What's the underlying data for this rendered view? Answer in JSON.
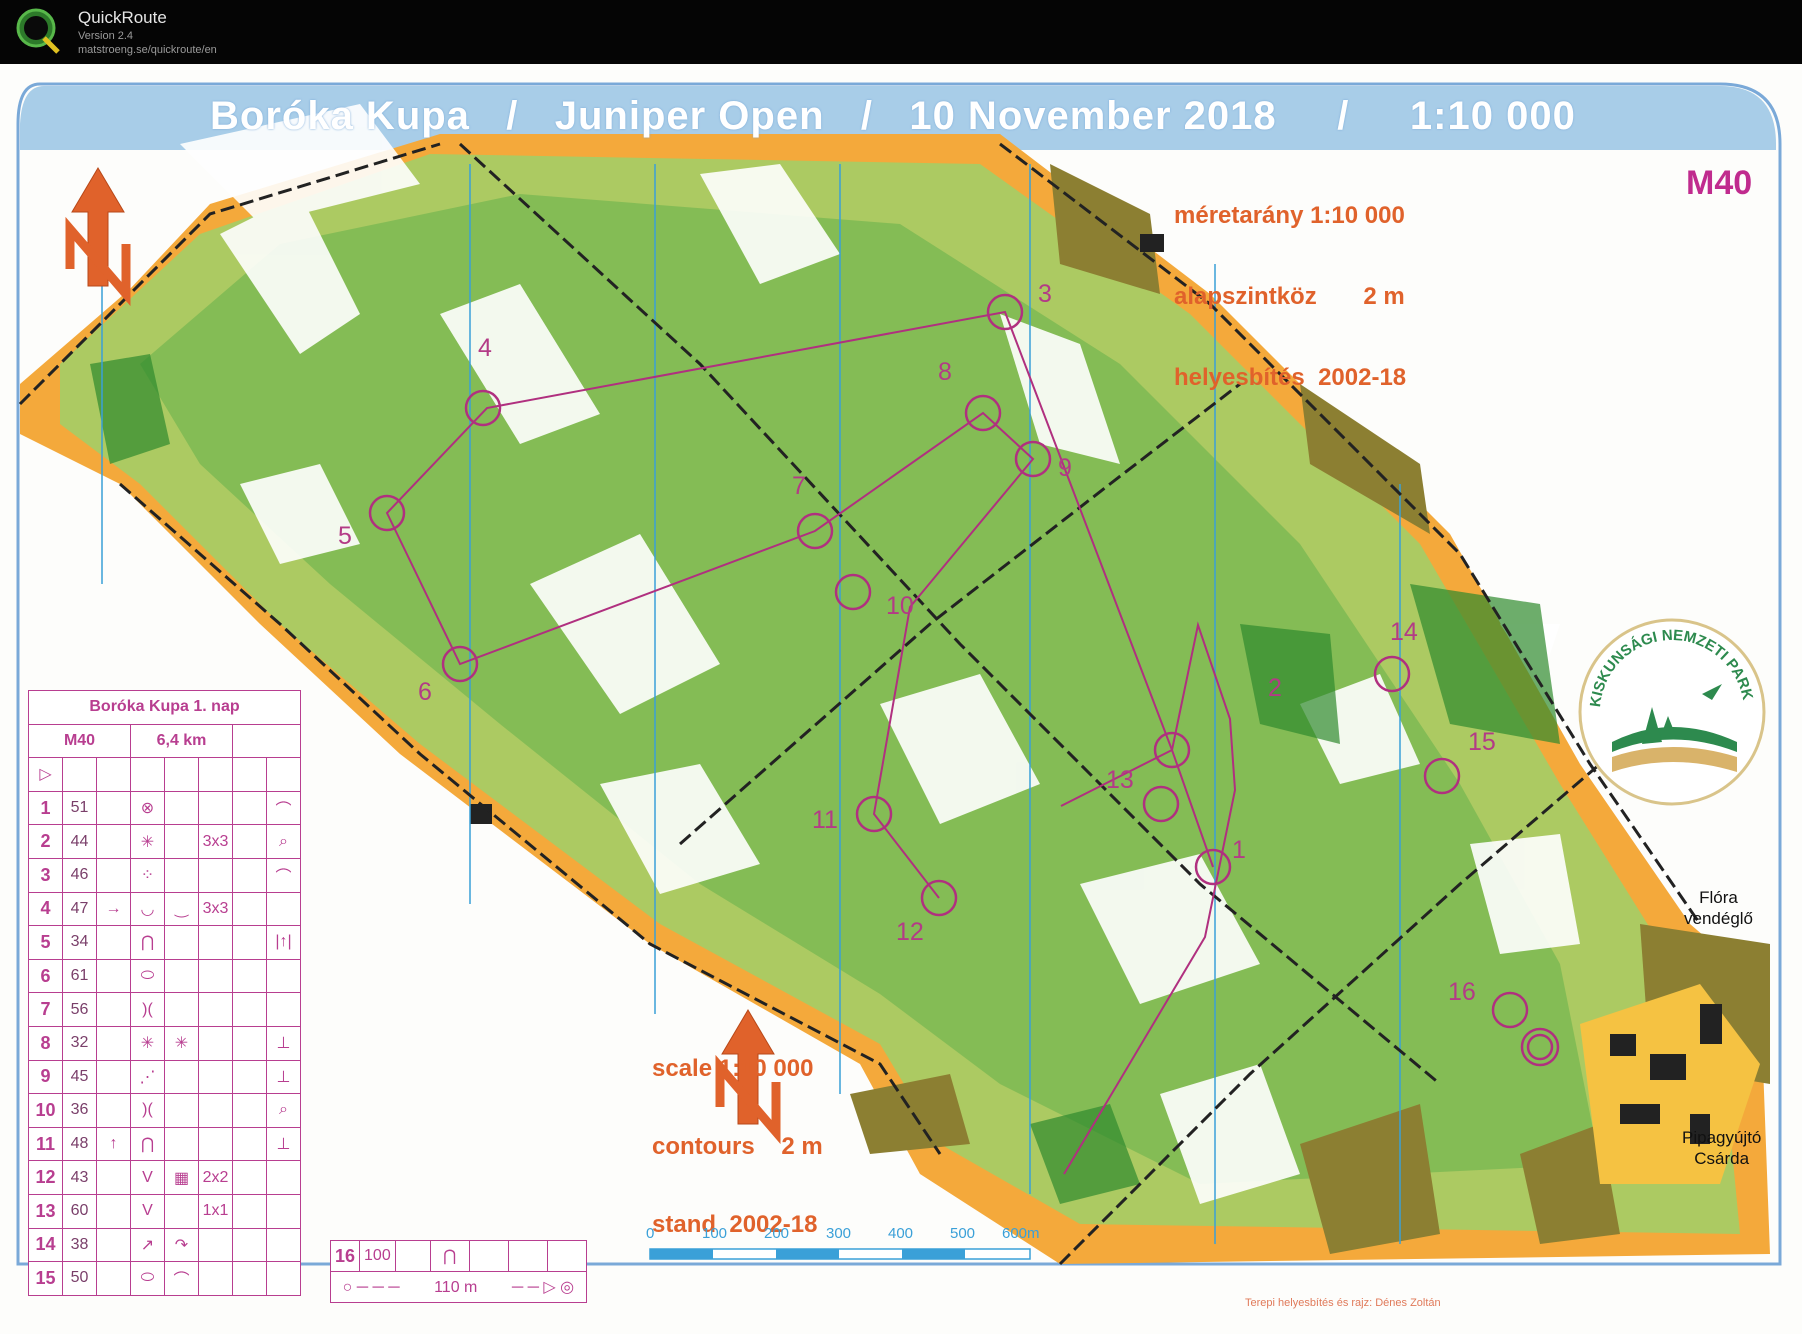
{
  "app": {
    "name": "QuickRoute",
    "version": "Version 2.4",
    "url": "matstroeng.se/quickroute/en"
  },
  "map": {
    "banner": "Boróka Kupa   /   Juniper Open   /   10 November 2018     /     1:10 000",
    "info_hu": [
      "méretarány 1:10 000",
      "alapszintköz       2 m",
      "helyesbítés  2002-18"
    ],
    "course": "M40",
    "info_en": [
      "scale 1:10 000",
      "contours    2 m",
      "stand  2002-18"
    ],
    "places": {
      "flora": [
        "Flóra",
        "vendéglő"
      ],
      "pipa": [
        "Pipagyújtó",
        "Csárda"
      ]
    },
    "park_logo_text": "KISKUNSÁGI NEMZETI PARK",
    "credit": "Terepi helyesbítés és rajz: Dénes Zoltán",
    "scale_bar": {
      "labels": [
        "0",
        "100",
        "200",
        "300",
        "400",
        "500",
        "600m"
      ]
    },
    "controls": [
      "1",
      "2",
      "3",
      "4",
      "5",
      "6",
      "7",
      "8",
      "9",
      "10",
      "11",
      "12",
      "13",
      "14",
      "15",
      "16"
    ],
    "colors": {
      "open_land": "#f4a93b",
      "forest": "#7dbd4a",
      "dense_forest": "#3e9b3a",
      "overprint": "#b0307f",
      "brown": "#7a6a2a",
      "banner": "#a8cde8"
    }
  },
  "descriptions": {
    "title": "Boróka Kupa 1. nap",
    "course": "M40",
    "length": "6,4 km",
    "rows": [
      {
        "n": "1",
        "code": "51",
        "d": "",
        "e": "⊗",
        "f": "",
        "g": "",
        "h": "⌒"
      },
      {
        "n": "2",
        "code": "44",
        "d": "",
        "e": "✳",
        "f": "",
        "g": "3x3",
        "h": "⌕"
      },
      {
        "n": "3",
        "code": "46",
        "d": "",
        "e": "⁘",
        "f": "",
        "g": "",
        "h": "⌒"
      },
      {
        "n": "4",
        "code": "47",
        "d": "→",
        "e": "◡",
        "f": "‿",
        "g": "3x3",
        "h": ""
      },
      {
        "n": "5",
        "code": "34",
        "d": "",
        "e": "⋂",
        "f": "",
        "g": "",
        "h": "|↑|"
      },
      {
        "n": "6",
        "code": "61",
        "d": "",
        "e": "⬭",
        "f": "",
        "g": "",
        "h": ""
      },
      {
        "n": "7",
        "code": "56",
        "d": "",
        "e": ")(",
        "f": "",
        "g": "",
        "h": ""
      },
      {
        "n": "8",
        "code": "32",
        "d": "",
        "e": "✳",
        "f": "✳",
        "g": "",
        "h": "⊥"
      },
      {
        "n": "9",
        "code": "45",
        "d": "",
        "e": "⋰",
        "f": "",
        "g": "",
        "h": "⊥"
      },
      {
        "n": "10",
        "code": "36",
        "d": "",
        "e": ")(",
        "f": "",
        "g": "",
        "h": "⌕"
      },
      {
        "n": "11",
        "code": "48",
        "d": "↑",
        "e": "⋂",
        "f": "",
        "g": "",
        "h": "⊥"
      },
      {
        "n": "12",
        "code": "43",
        "d": "",
        "e": "V",
        "f": "▦",
        "g": "2x2",
        "h": ""
      },
      {
        "n": "13",
        "code": "60",
        "d": "",
        "e": "V",
        "f": "",
        "g": "1x1",
        "h": ""
      },
      {
        "n": "14",
        "code": "38",
        "d": "",
        "e": "↗",
        "f": "↷",
        "g": "",
        "h": ""
      },
      {
        "n": "15",
        "code": "50",
        "d": "",
        "e": "⬭",
        "f": "⌒",
        "g": "",
        "h": ""
      }
    ],
    "leg": {
      "n": "16",
      "code": "100",
      "sym": "⋂",
      "distance": "110 m"
    }
  }
}
